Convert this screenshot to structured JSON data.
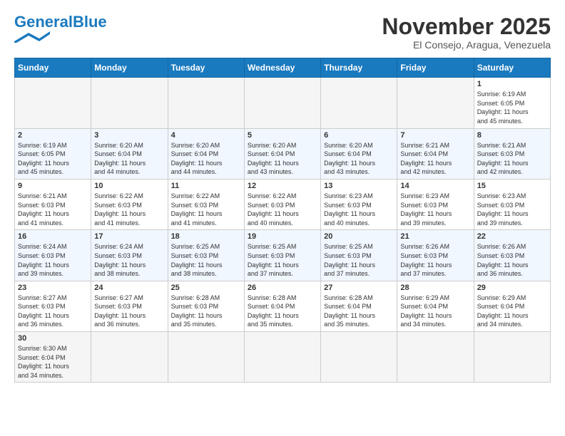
{
  "header": {
    "logo_general": "General",
    "logo_blue": "Blue",
    "month_title": "November 2025",
    "location": "El Consejo, Aragua, Venezuela"
  },
  "days_of_week": [
    "Sunday",
    "Monday",
    "Tuesday",
    "Wednesday",
    "Thursday",
    "Friday",
    "Saturday"
  ],
  "weeks": [
    {
      "days": [
        {
          "number": "",
          "info": ""
        },
        {
          "number": "",
          "info": ""
        },
        {
          "number": "",
          "info": ""
        },
        {
          "number": "",
          "info": ""
        },
        {
          "number": "",
          "info": ""
        },
        {
          "number": "",
          "info": ""
        },
        {
          "number": "1",
          "info": "Sunrise: 6:19 AM\nSunset: 6:05 PM\nDaylight: 11 hours\nand 45 minutes."
        }
      ]
    },
    {
      "days": [
        {
          "number": "2",
          "info": "Sunrise: 6:19 AM\nSunset: 6:05 PM\nDaylight: 11 hours\nand 45 minutes."
        },
        {
          "number": "3",
          "info": "Sunrise: 6:20 AM\nSunset: 6:04 PM\nDaylight: 11 hours\nand 44 minutes."
        },
        {
          "number": "4",
          "info": "Sunrise: 6:20 AM\nSunset: 6:04 PM\nDaylight: 11 hours\nand 44 minutes."
        },
        {
          "number": "5",
          "info": "Sunrise: 6:20 AM\nSunset: 6:04 PM\nDaylight: 11 hours\nand 43 minutes."
        },
        {
          "number": "6",
          "info": "Sunrise: 6:20 AM\nSunset: 6:04 PM\nDaylight: 11 hours\nand 43 minutes."
        },
        {
          "number": "7",
          "info": "Sunrise: 6:21 AM\nSunset: 6:04 PM\nDaylight: 11 hours\nand 42 minutes."
        },
        {
          "number": "8",
          "info": "Sunrise: 6:21 AM\nSunset: 6:03 PM\nDaylight: 11 hours\nand 42 minutes."
        }
      ]
    },
    {
      "days": [
        {
          "number": "9",
          "info": "Sunrise: 6:21 AM\nSunset: 6:03 PM\nDaylight: 11 hours\nand 41 minutes."
        },
        {
          "number": "10",
          "info": "Sunrise: 6:22 AM\nSunset: 6:03 PM\nDaylight: 11 hours\nand 41 minutes."
        },
        {
          "number": "11",
          "info": "Sunrise: 6:22 AM\nSunset: 6:03 PM\nDaylight: 11 hours\nand 41 minutes."
        },
        {
          "number": "12",
          "info": "Sunrise: 6:22 AM\nSunset: 6:03 PM\nDaylight: 11 hours\nand 40 minutes."
        },
        {
          "number": "13",
          "info": "Sunrise: 6:23 AM\nSunset: 6:03 PM\nDaylight: 11 hours\nand 40 minutes."
        },
        {
          "number": "14",
          "info": "Sunrise: 6:23 AM\nSunset: 6:03 PM\nDaylight: 11 hours\nand 39 minutes."
        },
        {
          "number": "15",
          "info": "Sunrise: 6:23 AM\nSunset: 6:03 PM\nDaylight: 11 hours\nand 39 minutes."
        }
      ]
    },
    {
      "days": [
        {
          "number": "16",
          "info": "Sunrise: 6:24 AM\nSunset: 6:03 PM\nDaylight: 11 hours\nand 39 minutes."
        },
        {
          "number": "17",
          "info": "Sunrise: 6:24 AM\nSunset: 6:03 PM\nDaylight: 11 hours\nand 38 minutes."
        },
        {
          "number": "18",
          "info": "Sunrise: 6:25 AM\nSunset: 6:03 PM\nDaylight: 11 hours\nand 38 minutes."
        },
        {
          "number": "19",
          "info": "Sunrise: 6:25 AM\nSunset: 6:03 PM\nDaylight: 11 hours\nand 37 minutes."
        },
        {
          "number": "20",
          "info": "Sunrise: 6:25 AM\nSunset: 6:03 PM\nDaylight: 11 hours\nand 37 minutes."
        },
        {
          "number": "21",
          "info": "Sunrise: 6:26 AM\nSunset: 6:03 PM\nDaylight: 11 hours\nand 37 minutes."
        },
        {
          "number": "22",
          "info": "Sunrise: 6:26 AM\nSunset: 6:03 PM\nDaylight: 11 hours\nand 36 minutes."
        }
      ]
    },
    {
      "days": [
        {
          "number": "23",
          "info": "Sunrise: 6:27 AM\nSunset: 6:03 PM\nDaylight: 11 hours\nand 36 minutes."
        },
        {
          "number": "24",
          "info": "Sunrise: 6:27 AM\nSunset: 6:03 PM\nDaylight: 11 hours\nand 36 minutes."
        },
        {
          "number": "25",
          "info": "Sunrise: 6:28 AM\nSunset: 6:03 PM\nDaylight: 11 hours\nand 35 minutes."
        },
        {
          "number": "26",
          "info": "Sunrise: 6:28 AM\nSunset: 6:04 PM\nDaylight: 11 hours\nand 35 minutes."
        },
        {
          "number": "27",
          "info": "Sunrise: 6:28 AM\nSunset: 6:04 PM\nDaylight: 11 hours\nand 35 minutes."
        },
        {
          "number": "28",
          "info": "Sunrise: 6:29 AM\nSunset: 6:04 PM\nDaylight: 11 hours\nand 34 minutes."
        },
        {
          "number": "29",
          "info": "Sunrise: 6:29 AM\nSunset: 6:04 PM\nDaylight: 11 hours\nand 34 minutes."
        }
      ]
    },
    {
      "days": [
        {
          "number": "30",
          "info": "Sunrise: 6:30 AM\nSunset: 6:04 PM\nDaylight: 11 hours\nand 34 minutes."
        },
        {
          "number": "",
          "info": ""
        },
        {
          "number": "",
          "info": ""
        },
        {
          "number": "",
          "info": ""
        },
        {
          "number": "",
          "info": ""
        },
        {
          "number": "",
          "info": ""
        },
        {
          "number": "",
          "info": ""
        }
      ]
    }
  ]
}
